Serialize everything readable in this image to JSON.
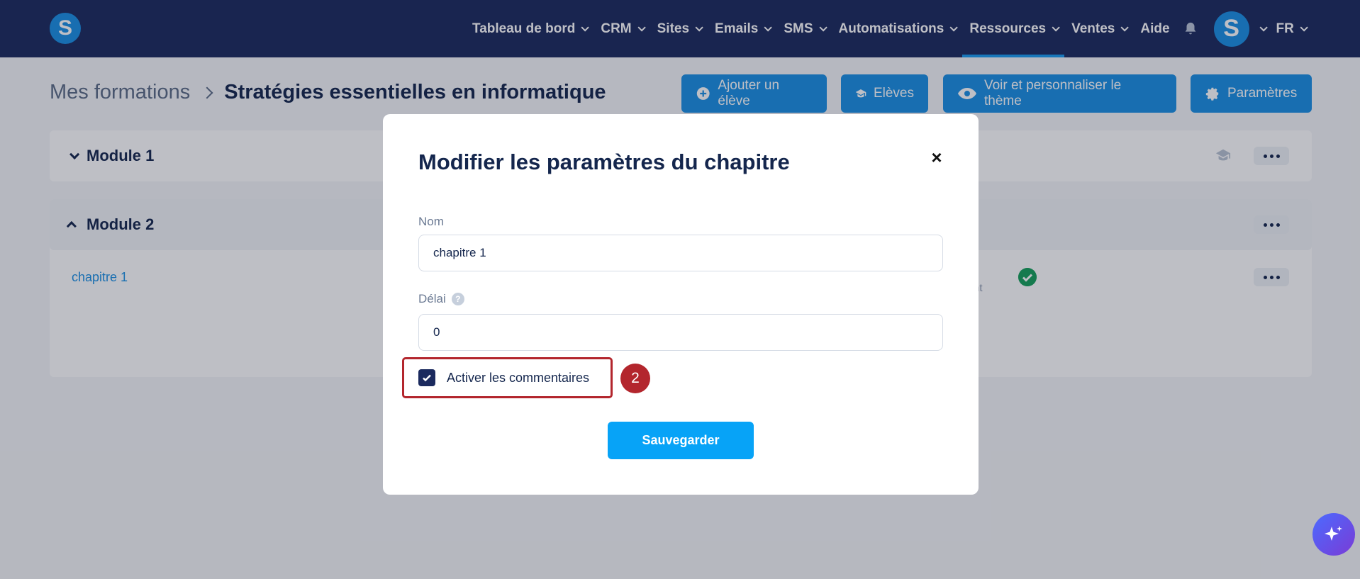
{
  "app": {
    "logo_letter": "S",
    "brand_color": "#1b2a5e",
    "accent_color": "#1a8fe3"
  },
  "nav": {
    "items": [
      {
        "label": "Tableau de bord",
        "has_dropdown": true
      },
      {
        "label": "CRM",
        "has_dropdown": true
      },
      {
        "label": "Sites",
        "has_dropdown": true
      },
      {
        "label": "Emails",
        "has_dropdown": true
      },
      {
        "label": "SMS",
        "has_dropdown": true
      },
      {
        "label": "Automatisations",
        "has_dropdown": true
      },
      {
        "label": "Ressources",
        "has_dropdown": true,
        "active": true
      },
      {
        "label": "Ventes",
        "has_dropdown": true
      },
      {
        "label": "Aide",
        "has_dropdown": false
      }
    ],
    "bell_icon": "bell-icon",
    "avatar_letter": "S",
    "language": "FR"
  },
  "breadcrumb": {
    "root": "Mes formations",
    "current": "Stratégies essentielles en informatique"
  },
  "actions": {
    "add_student": "Ajouter un élève",
    "students": "Elèves",
    "theme": "Voir et personnaliser le thème",
    "settings": "Paramètres"
  },
  "modules": [
    {
      "title": "Module 1",
      "expanded": false
    },
    {
      "title": "Module 2",
      "expanded": true,
      "chapters": [
        {
          "title": "chapitre 1",
          "status_text": "nt",
          "published": true
        }
      ]
    }
  ],
  "modal": {
    "title": "Modifier les paramètres du chapitre",
    "name_label": "Nom",
    "name_value": "chapitre 1",
    "delay_label": "Délai",
    "delay_help": "?",
    "delay_value": "0",
    "comments_label": "Activer les commentaires",
    "comments_checked": true,
    "step_number": "2",
    "save_label": "Sauvegarder",
    "close_symbol": "×"
  }
}
